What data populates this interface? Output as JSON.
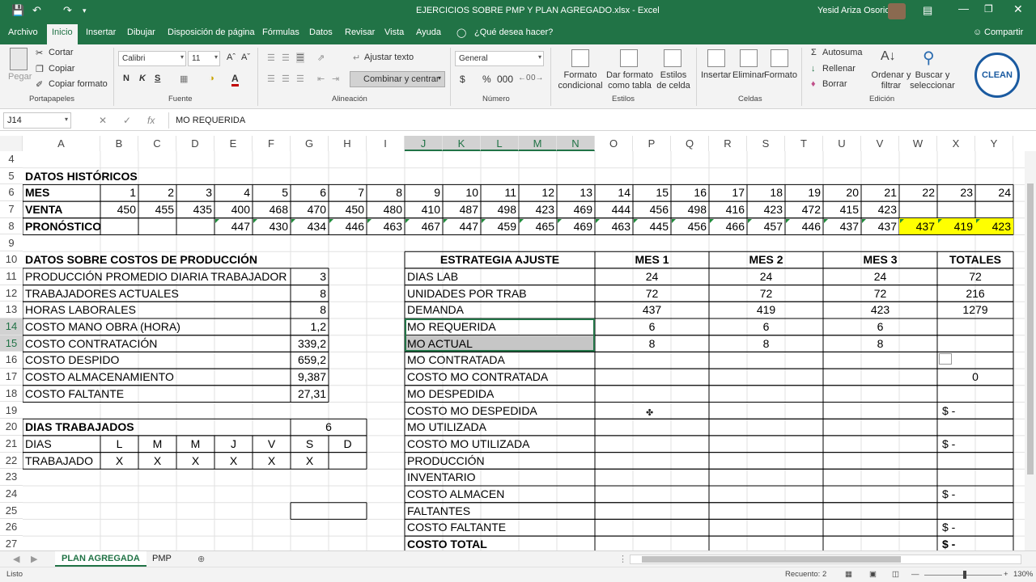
{
  "titlebar": {
    "filename": "EJERCICIOS SOBRE PMP Y PLAN AGREGADO.xlsx  -  Excel",
    "user": "Yesid Ariza Osorio"
  },
  "tabs": [
    "Archivo",
    "Inicio",
    "Insertar",
    "Dibujar",
    "Disposición de página",
    "Fórmulas",
    "Datos",
    "Revisar",
    "Vista",
    "Ayuda"
  ],
  "tell_me": "¿Qué desea hacer?",
  "share": "Compartir",
  "ribbon": {
    "clipboard": {
      "paste": "Pegar",
      "cut": "Cortar",
      "copy": "Copiar",
      "format": "Copiar formato",
      "label": "Portapapeles"
    },
    "font": {
      "name": "Calibri",
      "size": "11",
      "label": "Fuente",
      "bold": "N",
      "italic": "K",
      "underline": "S"
    },
    "alignment": {
      "wrap": "Ajustar texto",
      "merge": "Combinar y centrar",
      "label": "Alineación"
    },
    "number": {
      "format": "General",
      "label": "Número"
    },
    "styles": {
      "cond": "Formato condicional",
      "table": "Dar formato como tabla",
      "cell": "Estilos de celda",
      "label": "Estilos"
    },
    "cells": {
      "insert": "Insertar",
      "delete": "Eliminar",
      "format": "Formato",
      "label": "Celdas"
    },
    "editing": {
      "autosum": "Autosuma",
      "fill": "Rellenar",
      "clear": "Borrar",
      "sort": "Ordenar y filtrar",
      "find": "Buscar y seleccionar",
      "label": "Edición"
    },
    "logo": "CLEAN"
  },
  "namebox": "J14",
  "formula": "MO REQUERIDA",
  "columns": [
    "A",
    "B",
    "C",
    "D",
    "E",
    "F",
    "G",
    "H",
    "I",
    "J",
    "K",
    "L",
    "M",
    "N",
    "O",
    "P",
    "Q",
    "R",
    "S",
    "T",
    "U",
    "V",
    "W",
    "X",
    "Y"
  ],
  "rows": [
    "4",
    "5",
    "6",
    "7",
    "8",
    "9",
    "10",
    "11",
    "12",
    "13",
    "14",
    "15",
    "16",
    "17",
    "18",
    "19",
    "20",
    "21",
    "22",
    "23",
    "24",
    "25",
    "26",
    "27"
  ],
  "historic": {
    "title": "DATOS HISTÓRICOS",
    "mes_label": "MES",
    "venta_label": "VENTA",
    "pron_label": "PRONÓSTICO",
    "meses": [
      "1",
      "2",
      "3",
      "4",
      "5",
      "6",
      "7",
      "8",
      "9",
      "10",
      "11",
      "12",
      "13",
      "14",
      "15",
      "16",
      "17",
      "18",
      "19",
      "20",
      "21",
      "22",
      "23",
      "24"
    ],
    "ventas": [
      "450",
      "455",
      "435",
      "400",
      "468",
      "470",
      "450",
      "480",
      "410",
      "487",
      "498",
      "423",
      "469",
      "444",
      "456",
      "498",
      "416",
      "423",
      "472",
      "415",
      "423",
      "",
      "",
      ""
    ],
    "pronostico": [
      "",
      "",
      "",
      "447",
      "430",
      "434",
      "446",
      "463",
      "467",
      "447",
      "459",
      "465",
      "469",
      "463",
      "445",
      "456",
      "466",
      "457",
      "446",
      "437",
      "437",
      "437",
      "419",
      "423"
    ]
  },
  "costos": {
    "title": "DATOS SOBRE COSTOS DE PRODUCCIÓN",
    "items": [
      {
        "label": "PRODUCCIÓN PROMEDIO DIARIA TRABAJADOR",
        "value": "3"
      },
      {
        "label": "TRABAJADORES ACTUALES",
        "value": "8"
      },
      {
        "label": "HORAS LABORALES",
        "value": "8"
      },
      {
        "label": "COSTO MANO OBRA (HORA)",
        "value": "1,2"
      },
      {
        "label": "COSTO CONTRATACIÓN",
        "value": "339,2"
      },
      {
        "label": "COSTO DESPIDO",
        "value": "659,2"
      },
      {
        "label": "COSTO ALMACENAMIENTO",
        "value": "9,387"
      },
      {
        "label": "COSTO FALTANTE",
        "value": "27,31"
      }
    ]
  },
  "dias": {
    "title": "DIAS TRABAJADOS",
    "count": "6",
    "dias_label": "DIAS",
    "dias": [
      "L",
      "M",
      "M",
      "J",
      "V",
      "S",
      "D"
    ],
    "trab_label": "TRABAJADO",
    "trab": [
      "X",
      "X",
      "X",
      "X",
      "X",
      "X",
      ""
    ]
  },
  "estrategia": {
    "headers": [
      "ESTRATEGIA AJUSTE",
      "MES 1",
      "MES 2",
      "MES 3",
      "TOTALES"
    ],
    "rows": [
      {
        "label": "DIAS LAB",
        "m1": "24",
        "m2": "24",
        "m3": "24",
        "tot": ""
      },
      {
        "label": "UNIDADES POR TRAB",
        "m1": "72",
        "m2": "72",
        "m3": "72",
        "tot": "216"
      },
      {
        "label": "DEMANDA",
        "m1": "437",
        "m2": "419",
        "m3": "423",
        "tot": "1279"
      },
      {
        "label": "MO REQUERIDA",
        "m1": "6",
        "m2": "6",
        "m3": "6",
        "tot": ""
      },
      {
        "label": "MO ACTUAL",
        "m1": "8",
        "m2": "8",
        "m3": "8",
        "tot": ""
      },
      {
        "label": "MO CONTRATADA",
        "m1": "",
        "m2": "",
        "m3": "",
        "tot": ""
      },
      {
        "label": "COSTO MO CONTRATADA",
        "m1": "",
        "m2": "",
        "m3": "",
        "tot": "0"
      },
      {
        "label": "MO DESPEDIDA",
        "m1": "",
        "m2": "",
        "m3": "",
        "tot": ""
      },
      {
        "label": "COSTO MO DESPEDIDA",
        "m1": "",
        "m2": "",
        "m3": "",
        "tot": "$ -"
      },
      {
        "label": "MO UTILIZADA",
        "m1": "",
        "m2": "",
        "m3": "",
        "tot": ""
      },
      {
        "label": "COSTO MO UTILIZADA",
        "m1": "",
        "m2": "",
        "m3": "",
        "tot": "$ -"
      },
      {
        "label": "PRODUCCIÓN",
        "m1": "",
        "m2": "",
        "m3": "",
        "tot": ""
      },
      {
        "label": "INVENTARIO",
        "m1": "",
        "m2": "",
        "m3": "",
        "tot": ""
      },
      {
        "label": "COSTO ALMACEN",
        "m1": "",
        "m2": "",
        "m3": "",
        "tot": "$ -"
      },
      {
        "label": "FALTANTES",
        "m1": "",
        "m2": "",
        "m3": "",
        "tot": ""
      },
      {
        "label": "COSTO FALTANTE",
        "m1": "",
        "m2": "",
        "m3": "",
        "tot": "$ -"
      },
      {
        "label": "COSTO TOTAL",
        "m1": "",
        "m2": "",
        "m3": "",
        "tot": "$ -"
      }
    ],
    "totales_first": "72"
  },
  "sheets": [
    "PLAN AGREGADA",
    "PMP"
  ],
  "status": {
    "mode": "Listo",
    "count": "Recuento: 2",
    "zoom": "130%"
  },
  "colors": {
    "excel_green": "#217346",
    "highlight": "#ffff00",
    "selection": "#c6c6c6"
  }
}
